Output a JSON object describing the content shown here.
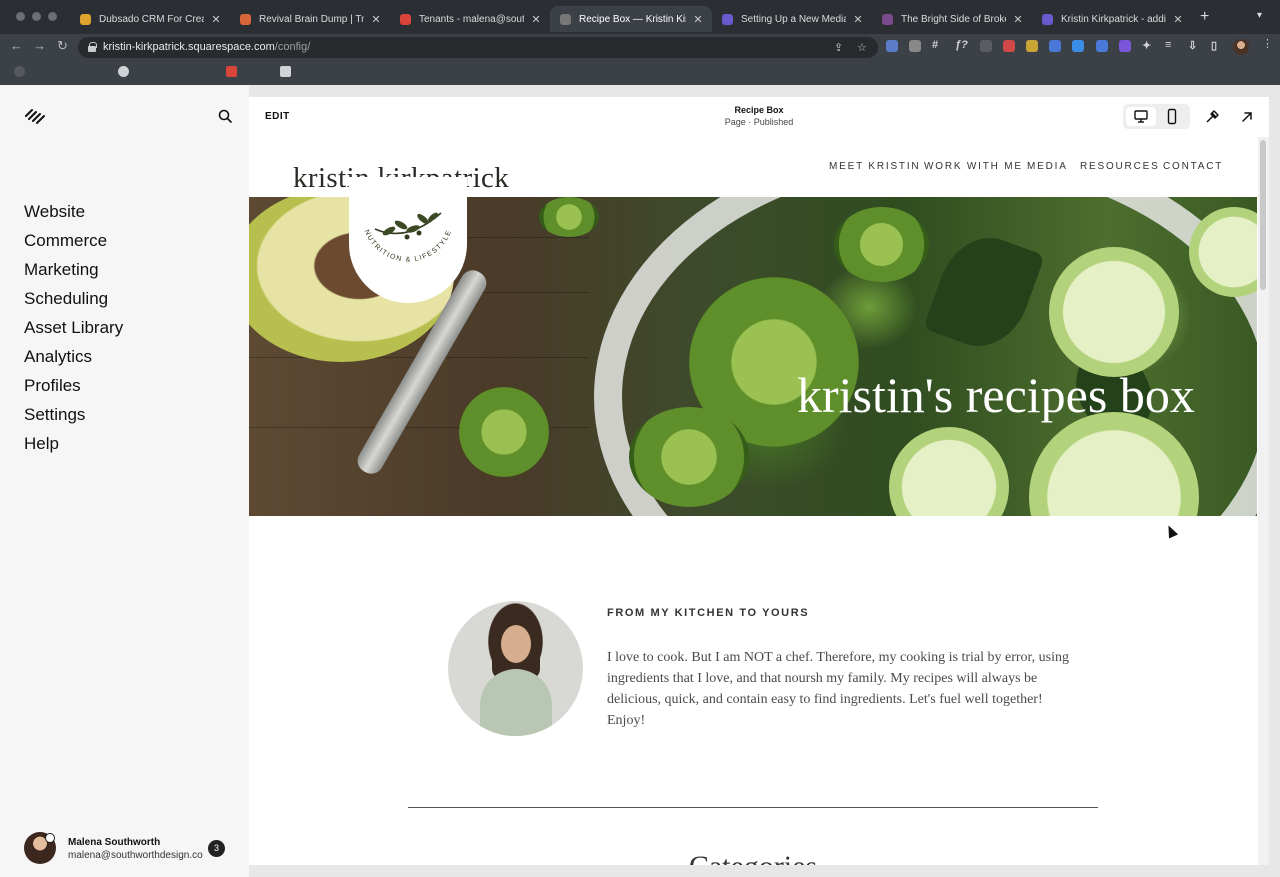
{
  "browser": {
    "tabs": [
      {
        "title": "Dubsado CRM For Creative",
        "favicon_color": "#e0a32e",
        "active": false
      },
      {
        "title": "Revival Brain Dump | Trello",
        "favicon_color": "#d9653b",
        "active": false
      },
      {
        "title": "Tenants - malena@southwo",
        "favicon_color": "#d9453b",
        "active": false
      },
      {
        "title": "Recipe Box — Kristin Kirkpa",
        "favicon_color": "#777777",
        "active": true
      },
      {
        "title": "Setting Up a New Media Po",
        "favicon_color": "#6a5acd",
        "active": false
      },
      {
        "title": "The Bright Side of Broken",
        "favicon_color": "#7a4b8c",
        "active": false
      },
      {
        "title": "Kristin Kirkpatrick - adding",
        "favicon_color": "#6a5acd",
        "active": false
      }
    ],
    "url_host": "kristin-kirkpatrick.squarespace.com",
    "url_path": "/config/",
    "new_tab_glyph": "+",
    "extension_colors": [
      "#5b7cc9",
      "#888888",
      "#d04848",
      "#c9a634",
      "#4a78d9",
      "#3c8de6",
      "#7a55d9"
    ]
  },
  "sidebar": {
    "nav": [
      "Website",
      "Commerce",
      "Marketing",
      "Scheduling",
      "Asset Library",
      "Analytics",
      "Profiles",
      "Settings",
      "Help"
    ],
    "user": {
      "name": "Malena Southworth",
      "email": "malena@southworthdesign.co",
      "notifications": "3"
    }
  },
  "editor": {
    "edit_label": "EDIT",
    "page_title": "Recipe Box",
    "page_status": "Page · Published"
  },
  "site": {
    "brand": "kristin kirkpatrick",
    "nav": [
      "MEET KRISTIN",
      "WORK WITH ME",
      "MEDIA",
      "RESOURCES",
      "CONTACT"
    ],
    "hero_title": "kristin's recipes box",
    "logo_text": "NUTRITION & LIFESTYLE",
    "bio_heading": "FROM MY KITCHEN TO YOURS",
    "bio_text": "I love to cook. But I am NOT a chef. Therefore, my cooking is trial by error, using ingredients that I love, and that noursh my family. My recipes will always be delicious, quick, and contain easy to find ingredients. Let's fuel well together! Enjoy!",
    "next_heading": "Categories"
  },
  "colors": {
    "chrome_dark": "#2b2e33",
    "chrome_toolbar": "#3c4047",
    "sidebar_bg": "#f6f6f6",
    "text_dark": "#111111"
  }
}
